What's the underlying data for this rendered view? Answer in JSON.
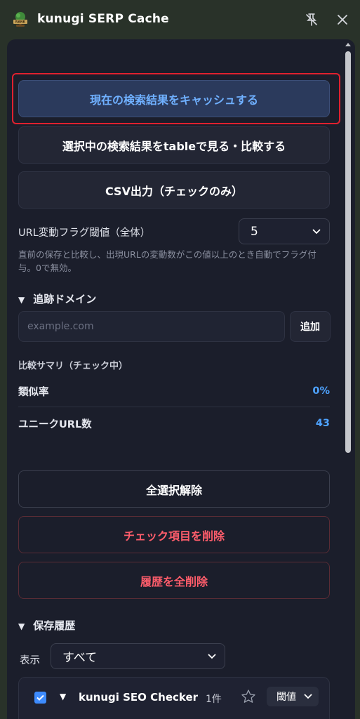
{
  "window": {
    "title": "kunugi SERP Cache",
    "logo_text": "RANK"
  },
  "actions": {
    "cache_current": "現在の検索結果をキャッシュする",
    "view_compare": "選択中の検索結果をtableで見る・比較する",
    "csv_export": "CSV出力（チェックのみ）"
  },
  "url_flag": {
    "label": "URL変動フラグ閾値（全体）",
    "value": "5",
    "help": "直前の保存と比較し、出現URLの変動数がこの値以上のとき自動でフラグ付与。0で無効。"
  },
  "tracked_domains": {
    "header": "追跡ドメイン",
    "placeholder": "example.com",
    "value": "",
    "add_label": "追加"
  },
  "summary": {
    "header": "比較サマリ（チェック中）",
    "rows": [
      {
        "label": "類似率",
        "value": "0%"
      },
      {
        "label": "ユニークURL数",
        "value": "43"
      }
    ]
  },
  "bulk": {
    "deselect_all": "全選択解除",
    "delete_checked": "チェック項目を削除",
    "delete_all": "履歴を全削除"
  },
  "history": {
    "header": "保存履歴",
    "filter_label": "表示",
    "filter_value": "すべて",
    "groups": [
      {
        "title": "kunugi SEO Checker",
        "count": "1件",
        "threshold_label": "閾値",
        "checked": true
      }
    ]
  },
  "colors": {
    "accent": "#4ea3ff",
    "danger": "#ff5d6b",
    "focus_ring": "#e0212f",
    "window_bg": "#293229",
    "panel_bg": "#1b1e2b"
  },
  "icons": {
    "pin": "unpin-icon",
    "close": "close-icon",
    "star": "star-outline-icon",
    "chevron": "chevron-down-icon"
  }
}
